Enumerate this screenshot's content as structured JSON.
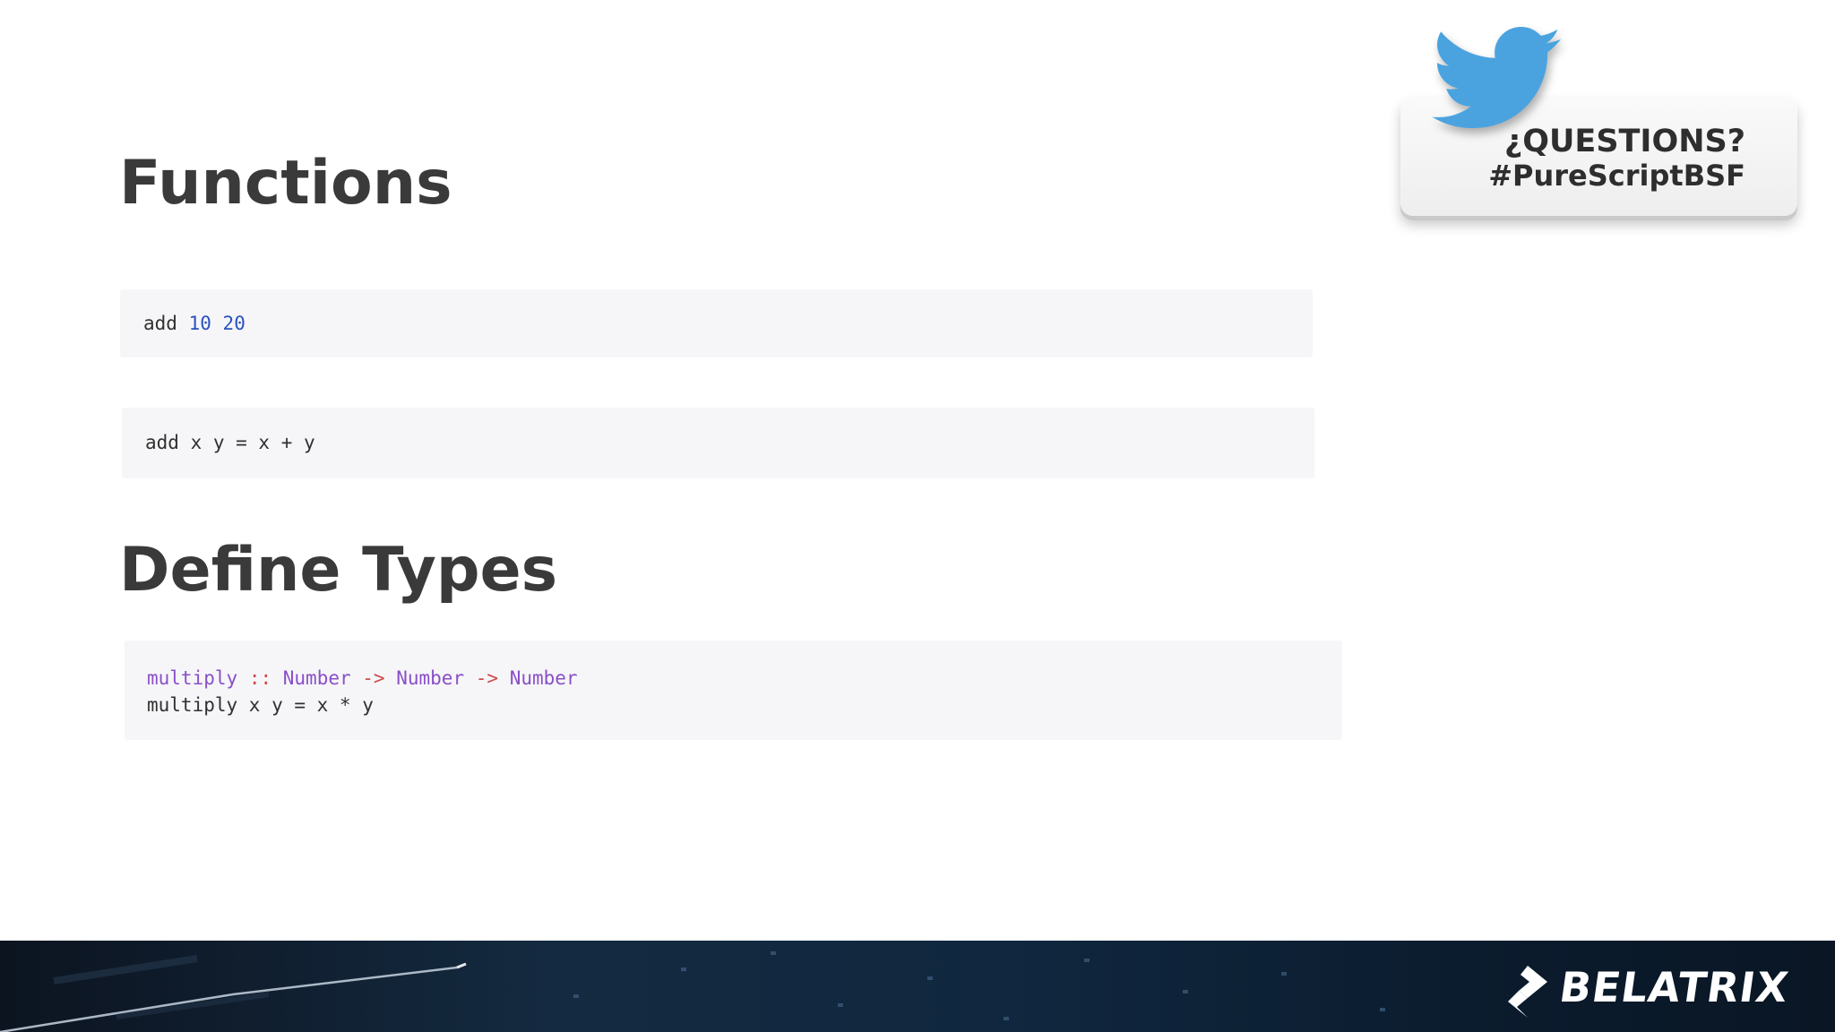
{
  "slide": {
    "heading_functions": "Functions",
    "heading_types": "Define Types"
  },
  "code": {
    "call_example": {
      "fn": "add",
      "arg1": "10",
      "arg2": "20"
    },
    "definition": "add x y = x + y",
    "typed": {
      "line1_name": "multiply",
      "line1_sep": "::",
      "type1": "Number",
      "arrow1": "->",
      "type2": "Number",
      "arrow2": "->",
      "type3": "Number",
      "line2": "multiply x y = x * y"
    }
  },
  "card": {
    "line1": "¿QUESTIONS?",
    "line2": "#PureScriptBSF",
    "icon": "twitter-bird-icon"
  },
  "footer": {
    "brand": "BELATRIX",
    "logo_icon": "belatrix-logo-icon"
  },
  "colors": {
    "keyword": "#8a4fc8",
    "number": "#2a52be",
    "operator": "#d04a4a",
    "twitter": "#4aa3df",
    "heading": "#3a3a3a"
  }
}
